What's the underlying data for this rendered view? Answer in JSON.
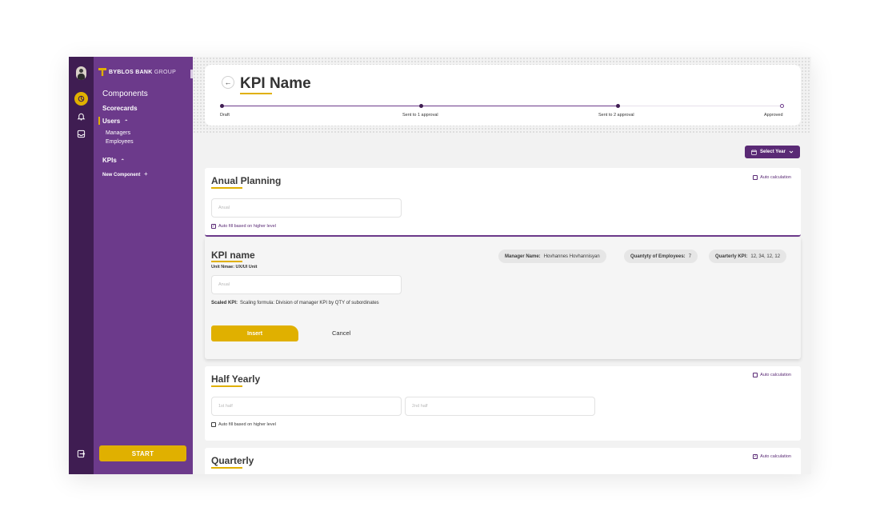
{
  "brand": {
    "name_bold": "BYBLOS BANK",
    "name_light": "GROUP"
  },
  "sidebar": {
    "heading": "Components",
    "items": [
      {
        "label": "Scorecards"
      },
      {
        "label": "Users"
      },
      {
        "label": "Managers"
      },
      {
        "label": "Employees"
      },
      {
        "label": "KPIs"
      },
      {
        "label": "New Component"
      }
    ],
    "new_component_plus": "+",
    "start_label": "START"
  },
  "rail": {
    "icons": [
      "avatar",
      "home-icon",
      "bell-icon",
      "inbox-icon",
      "logout-icon"
    ]
  },
  "header": {
    "back_glyph": "←",
    "title": "KPI Name",
    "steps": [
      "Draft",
      "Sent to 1 approval",
      "Sent to 2 approval",
      "Approved"
    ]
  },
  "toolbar": {
    "select_year_label": "Select Year"
  },
  "annual": {
    "title": "Anual Planning",
    "auto_calc_label": "Auto calculation",
    "input_placeholder": "Anual",
    "autofill_label": "Auto fill based on higher level"
  },
  "kpi": {
    "title": "KPI name",
    "unit_name": "Unit Nmae: UX/UI Unit",
    "manager_label": "Manager Name:",
    "manager_value": "Hovhannes Hovhannisyan",
    "employees_label": "Quantyty of Employees:",
    "employees_value": "7",
    "quarterly_label": "Quarterly KPI:",
    "quarterly_value": "12, 34, 12, 12",
    "input_placeholder": "Anual",
    "scaled_label": "Scaled KPI:",
    "scaled_value": "Scaling formula: Division of manager KPI by QTY of subordinates",
    "insert_label": "Insert",
    "cancel_label": "Cancel"
  },
  "half": {
    "title": "Half Yearly",
    "auto_calc_label": "Auto calculation",
    "first_placeholder": "1st half",
    "second_placeholder": "2nd half",
    "autofill_label": "Auto fill based on higher level"
  },
  "quarterly": {
    "title": "Quarterly",
    "auto_calc_label": "Auto calculation"
  },
  "colors": {
    "purple_dark": "#3f1d52",
    "purple": "#6c3a8b",
    "accent": "#e0b000"
  }
}
